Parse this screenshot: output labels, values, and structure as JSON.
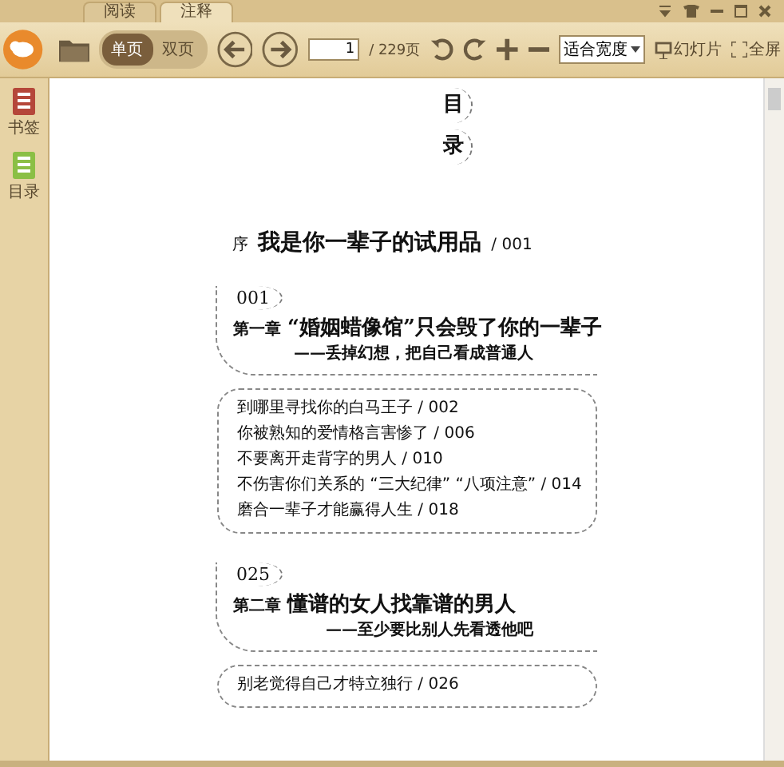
{
  "tabs": [
    {
      "label": "阅读",
      "selected": false
    },
    {
      "label": "注释",
      "selected": true
    }
  ],
  "toolbar": {
    "view_modes": [
      {
        "label": "单页",
        "selected": true
      },
      {
        "label": "双页",
        "selected": false
      }
    ],
    "page_input": "1",
    "page_total": "/ 229页",
    "zoom_select": "适合宽度",
    "slideshow": "幻灯片",
    "fullscreen": "全屏"
  },
  "sidebar": {
    "items": [
      {
        "label": "书签",
        "color": "#b5473a"
      },
      {
        "label": "目录",
        "color": "#8bbf45"
      }
    ]
  },
  "document": {
    "heading": [
      "目",
      "录"
    ],
    "preface": {
      "prefix": "序",
      "title": "我是你一辈子的试用品",
      "page": "/ 001"
    },
    "chapters": [
      {
        "number": "001",
        "label": "第一章",
        "title": "“婚姻蜡像馆”只会毁了你的一辈子",
        "subtitle": "——丢掉幻想，把自己看成普通人",
        "sections": [
          "到哪里寻找你的白马王子 / 002",
          "你被熟知的爱情格言害惨了 / 006",
          "不要离开走背字的男人 / 010",
          "不伤害你们关系的 “三大纪律” “八项注意” / 014",
          "磨合一辈子才能赢得人生 / 018"
        ]
      },
      {
        "number": "025",
        "label": "第二章",
        "title": "懂谱的女人找靠谱的男人",
        "subtitle": "——至少要比别人先看透他吧",
        "sections": [
          "别老觉得自己才特立独行 / 026"
        ]
      }
    ]
  }
}
